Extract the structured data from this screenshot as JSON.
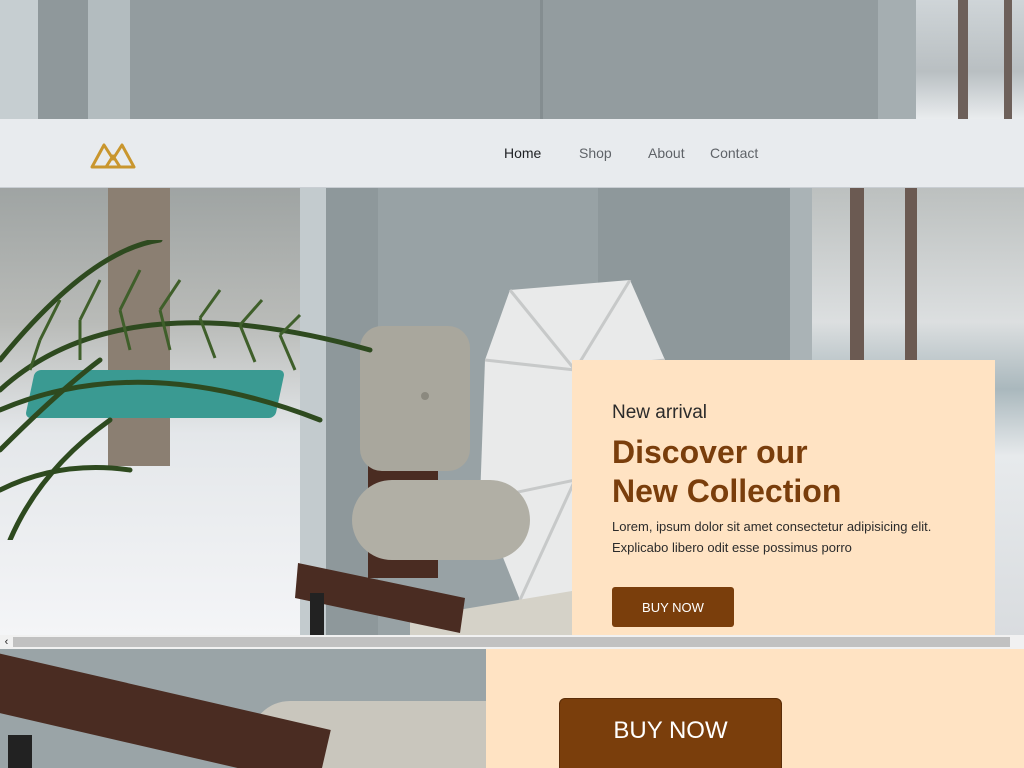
{
  "nav": {
    "logo_icon": "mountain-logo-icon",
    "links": [
      {
        "label": "Home",
        "active": true
      },
      {
        "label": "Shop",
        "active": false
      },
      {
        "label": "About",
        "active": false
      },
      {
        "label": "Contact",
        "active": false
      }
    ]
  },
  "hero": {
    "eyebrow": "New arrival",
    "title_line1": "Discover our",
    "title_line2": "New Collection",
    "description_line1": "Lorem, ipsum dolor sit amet consectetur adipisicing elit.",
    "description_line2": "Explicabo libero odit esse possimus porro",
    "cta_label": "BUY NOW"
  },
  "scrollbar": {
    "left_arrow_icon": "chevron-left-icon",
    "left_arrow_glyph": "‹"
  },
  "lower": {
    "cta_label": "BUY NOW"
  },
  "colors": {
    "accent_brown": "#7a3e0c",
    "card_peach": "#ffe3c3",
    "logo_gold": "#c9962e",
    "navbar_bg": "#e8ebee"
  }
}
